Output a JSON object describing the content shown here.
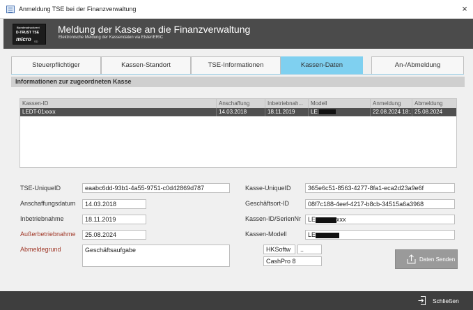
{
  "window": {
    "title": "Anmeldung TSE bei der Finanzverwaltung",
    "close_label": "×"
  },
  "header": {
    "title": "Meldung der Kasse an die Finanzverwaltung",
    "subtitle": "Elektronische Meldung der Kassendaten via Elster/ERIC",
    "logo": {
      "line1": "Bundesdruckerei",
      "line2": "D-TRUST TSE",
      "line3": "micro",
      "line4": "SD"
    }
  },
  "tabs": [
    {
      "label": "Steuerpflichtiger"
    },
    {
      "label": "Kassen-Standort"
    },
    {
      "label": "TSE-Informationen"
    },
    {
      "label": "Kassen-Daten"
    },
    {
      "label": "An-/Abmeldung"
    }
  ],
  "active_tab": "Kassen-Daten",
  "section": {
    "title": "Informationen zur zugeordneten Kasse"
  },
  "table": {
    "columns": [
      "Kassen-ID",
      "Anschaffung",
      "Inbetriebnah...",
      "Modell",
      "Anmeldung",
      "Abmeldung"
    ],
    "rows": [
      [
        "LEDT-01xxxx",
        "14.03.2018",
        "18.11.2019",
        "LE",
        "22.08.2024 18:...",
        "25.08.2024"
      ]
    ]
  },
  "form": {
    "tse_uniqueid": {
      "label": "TSE-UniqueID",
      "value": "eaabc6dd-93b1-4a55-9751-c0d42869d787"
    },
    "anschaffungsdatum": {
      "label": "Anschaffungsdatum",
      "value": "14.03.2018"
    },
    "inbetriebnahme": {
      "label": "Inbetriebnahme",
      "value": "18.11.2019"
    },
    "ausserbetriebnahme": {
      "label": "Außerbetriebnahme",
      "value": "25.08.2024"
    },
    "abmeldegrund": {
      "label": "Abmeldegrund",
      "value": "Geschäftsaufgabe"
    },
    "kasse_uniqueid": {
      "label": "Kasse-UniqueID",
      "value": "365e6c51-8563-4277-8fa1-eca2d23a9e6f"
    },
    "geschaeftsort_id": {
      "label": "Geschäftsort-ID",
      "value": "08f7c188-4eef-4217-b8cb-34515a6a3968"
    },
    "kassen_id_seriennr": {
      "label": "Kassen-ID/SerienNr",
      "value_prefix": "LE",
      "value_suffix": "xxx"
    },
    "kassen_modell": {
      "label": "Kassen-Modell",
      "value": "LE"
    },
    "hersteller": {
      "value": "HKSoftw",
      "extra": ".."
    },
    "software": {
      "value": "CashPro 8"
    }
  },
  "buttons": {
    "send": {
      "label": "Daten Senden",
      "icon": "upload-icon"
    },
    "close": {
      "label": "Schließen",
      "icon": "exit-icon"
    }
  },
  "colors": {
    "header_bg": "#4b4b4b",
    "active_tab": "#7fd0f0",
    "selected_row": "#505050",
    "footer_bg": "#3e3e3e",
    "accent_label": "#a13a2a"
  }
}
